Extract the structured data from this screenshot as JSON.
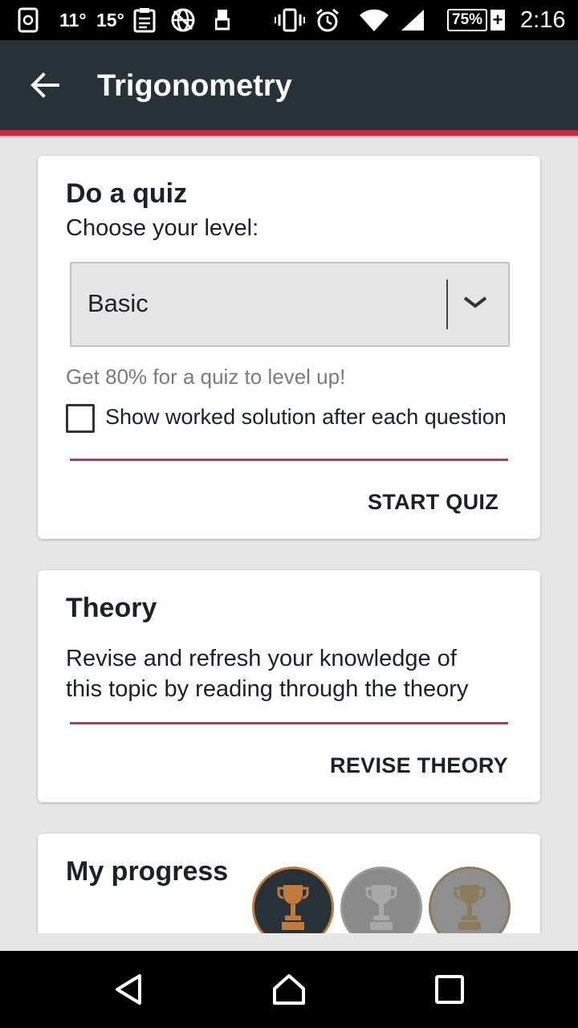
{
  "status_bar": {
    "temp1": "11°",
    "temp2": "15°",
    "battery": "75%",
    "battery_extra": "+",
    "time": "2:16"
  },
  "app_bar": {
    "title": "Trigonometry",
    "back_icon": "arrow-left-icon",
    "background_color": "#263238",
    "accent_color": "#c62e40"
  },
  "quiz_card": {
    "title": "Do a quiz",
    "subtitle": "Choose your level:",
    "level_select": {
      "value": "Basic"
    },
    "hint": "Get 80% for a quiz to level up!",
    "checkbox_label": "Show worked solution after each question",
    "checkbox_checked": false,
    "action": "START QUIZ"
  },
  "theory_card": {
    "title": "Theory",
    "description_line1": "Revise and refresh your knowledge of",
    "description_line2": "this topic by reading through the theory",
    "action": "REVISE THEORY"
  },
  "progress_card": {
    "title": "My progress",
    "trophies": [
      {
        "icon": "trophy-icon",
        "level": "bronze",
        "color": "#c07a3c"
      },
      {
        "icon": "trophy-icon",
        "level": "silver",
        "color": "#9a9a9a"
      },
      {
        "icon": "trophy-icon",
        "level": "gold",
        "color": "#8d7c5c"
      }
    ]
  },
  "nav_bar": {
    "back_icon": "triangle-back-icon",
    "home_icon": "home-icon",
    "recents_icon": "square-recents-icon"
  }
}
